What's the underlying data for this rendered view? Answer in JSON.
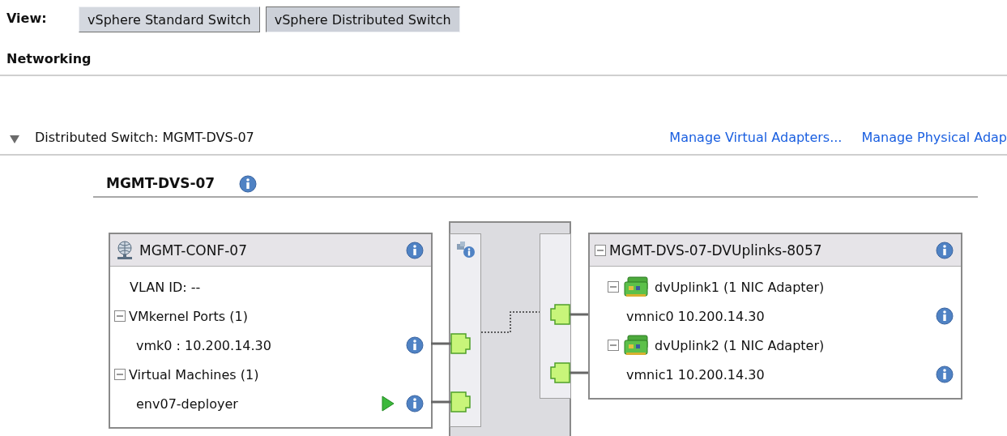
{
  "view": {
    "label": "View:",
    "options": [
      {
        "label": "vSphere Standard Switch",
        "selected": false
      },
      {
        "label": "vSphere Distributed Switch",
        "selected": true
      }
    ]
  },
  "section_title": "Networking",
  "switch": {
    "heading": "Distributed Switch: MGMT-DVS-07",
    "expanded": true,
    "links": [
      "Manage Virtual Adapters...",
      "Manage Physical Adap"
    ],
    "name": "MGMT-DVS-07",
    "port_group": {
      "name": "MGMT-CONF-07",
      "vlan": "VLAN ID: --",
      "sections": [
        {
          "title": "VMkernel Ports (1)",
          "expanded": true,
          "items": [
            {
              "label": "vmk0 : 10.200.14.30",
              "kind": "vmkernel"
            }
          ]
        },
        {
          "title": "Virtual Machines (1)",
          "expanded": true,
          "items": [
            {
              "label": "env07-deployer",
              "kind": "vm"
            }
          ]
        }
      ]
    },
    "uplinks": {
      "name": "MGMT-DVS-07-DVUplinks-8057",
      "expanded": true,
      "items": [
        {
          "name": "dvUplink1 (1 NIC Adapter)",
          "expanded": true,
          "adapter": "vmnic0 10.200.14.30"
        },
        {
          "name": "dvUplink2 (1 NIC Adapter)",
          "expanded": true,
          "adapter": "vmnic1 10.200.14.30"
        }
      ]
    }
  }
}
